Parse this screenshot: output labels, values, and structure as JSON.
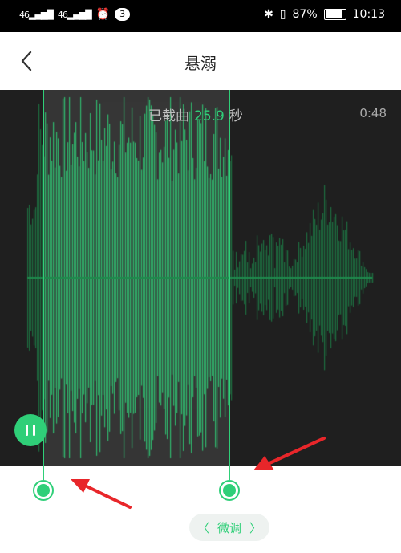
{
  "status_bar": {
    "signal_1": "46",
    "signal_2": "46",
    "notification_count": "3",
    "battery": "87%",
    "battery_level": 0.87,
    "time": "10:13"
  },
  "header": {
    "title": "悬溺"
  },
  "waveform": {
    "caption_prefix": "已截曲",
    "caption_value": "25.9",
    "caption_unit": "秒",
    "total_duration": "0:48",
    "accent_color": "#2fcf78"
  },
  "controls": {
    "fine_tune_label": "微调",
    "fine_tune_left": "〈",
    "fine_tune_right": "〉"
  }
}
